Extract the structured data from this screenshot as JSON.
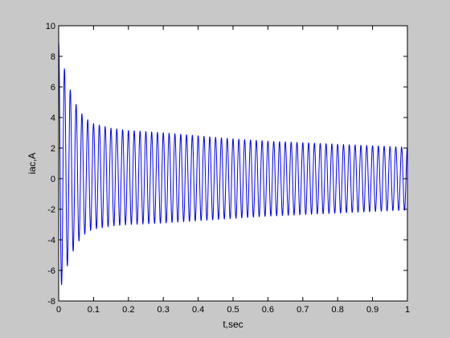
{
  "chart_data": {
    "type": "line",
    "title": "",
    "xlabel": "t,sec",
    "ylabel": "iac,A",
    "xlim": [
      0,
      1
    ],
    "ylim": [
      -8,
      10
    ],
    "grid": false,
    "x_ticks": [
      "0",
      "0.1",
      "0.2",
      "0.3",
      "0.4",
      "0.5",
      "0.6",
      "0.7",
      "0.8",
      "0.9",
      "1"
    ],
    "y_ticks": [
      "-8",
      "-6",
      "-4",
      "-2",
      "0",
      "2",
      "4",
      "6",
      "8",
      "10"
    ],
    "series": [
      {
        "color": "#0000ff",
        "frequency_hz": 60,
        "start_amplitude": 9.0,
        "settled_amplitude": 3.1,
        "final_amplitude": 2.05,
        "x": [
          0.0,
          0.02,
          0.04,
          0.06,
          0.08,
          0.1,
          0.15,
          0.2,
          0.3,
          0.4,
          0.5,
          0.6,
          0.7,
          0.8,
          0.9,
          1.0
        ],
        "upper_envelope": [
          9.0,
          6.8,
          5.3,
          4.4,
          3.9,
          3.6,
          3.3,
          3.15,
          3.0,
          2.8,
          2.6,
          2.45,
          2.35,
          2.25,
          2.15,
          2.05
        ],
        "lower_envelope": [
          -7.6,
          -6.0,
          -4.8,
          -4.0,
          -3.5,
          -3.3,
          -3.1,
          -3.0,
          -2.9,
          -2.75,
          -2.6,
          -2.45,
          -2.35,
          -2.25,
          -2.15,
          -2.05
        ]
      }
    ]
  }
}
